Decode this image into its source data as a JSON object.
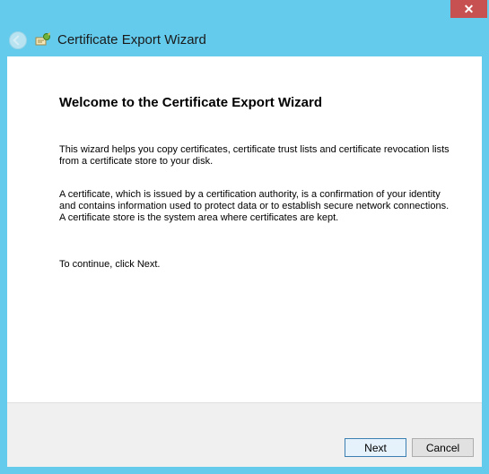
{
  "window": {
    "title": "Certificate Export Wizard",
    "close_glyph": "✕",
    "icons": [
      "back-arrow-icon",
      "certificate-wizard-icon",
      "close-icon"
    ]
  },
  "content": {
    "heading": "Welcome to the Certificate Export Wizard",
    "paragraph1": "This wizard helps you copy certificates, certificate trust lists and certificate revocation lists from a certificate store to your disk.",
    "paragraph2": "A certificate, which is issued by a certification authority, is a confirmation of your identity and contains information used to protect data or to establish secure network connections. A certificate store is the system area where certificates are kept.",
    "paragraph3": "To continue, click Next."
  },
  "buttons": {
    "next": "Next",
    "cancel": "Cancel"
  },
  "colors": {
    "title_bar": "#64cbec",
    "close_button": "#c75050",
    "content_bg": "#ffffff",
    "footer_bg": "#f0f0f0"
  }
}
